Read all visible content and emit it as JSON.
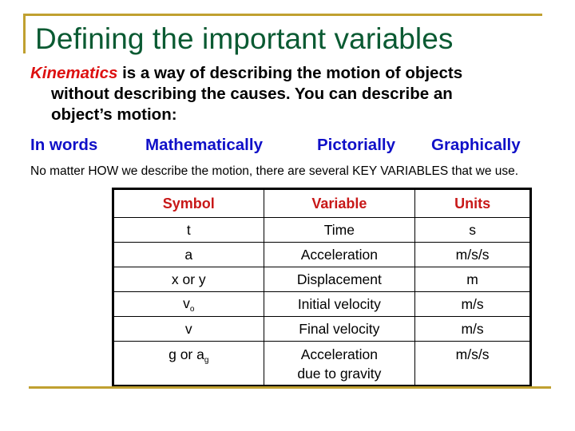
{
  "slide": {
    "title": "Defining the important variables",
    "intro": {
      "keyword": "Kinematics",
      "line1_rest": " is a way of describing the motion of objects",
      "line2": "without describing the causes. You can describe an",
      "line3": "object’s motion:"
    },
    "ways": [
      "In words",
      "Mathematically",
      "Pictorially",
      "Graphically"
    ],
    "note": "No matter HOW we describe the motion, there are several KEY VARIABLES that we use.",
    "colors": {
      "title": "#0a5a32",
      "keyword": "#dd1010",
      "ways": "#1010c8",
      "table_header": "#c81818",
      "accent_lines": "#c0a030"
    }
  },
  "table": {
    "headers": [
      "Symbol",
      "Variable",
      "Units"
    ],
    "rows": [
      {
        "symbol": "t",
        "symbol_sub": "",
        "variable": "Time",
        "units": "s"
      },
      {
        "symbol": "a",
        "symbol_sub": "",
        "variable": "Acceleration",
        "units": "m/s/s"
      },
      {
        "symbol": "x or y",
        "symbol_sub": "",
        "variable": "Displacement",
        "units": "m"
      },
      {
        "symbol": "v",
        "symbol_sub": "o",
        "variable": "Initial velocity",
        "units": "m/s"
      },
      {
        "symbol": "v",
        "symbol_sub": "",
        "variable": "Final velocity",
        "units": "m/s"
      },
      {
        "symbol": "g or a",
        "symbol_sub": "g",
        "variable": "Acceleration due to gravity",
        "units": "m/s/s"
      }
    ]
  }
}
